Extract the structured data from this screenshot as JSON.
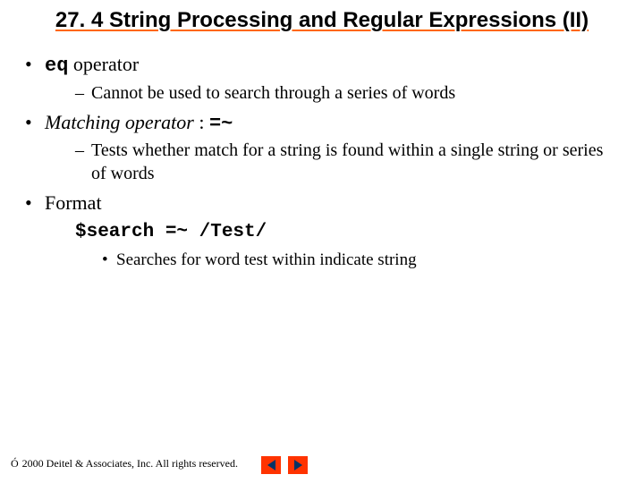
{
  "title": "27. 4 String Processing and Regular Expressions (II)",
  "bullets": {
    "b1_code": "eq",
    "b1_rest": " operator",
    "b1_sub1": "Cannot be used to search through a series of words",
    "b2_italic": "Matching operator",
    "b2_sep": " : ",
    "b2_code": "=~",
    "b2_sub1": "Tests whether match for a string is found within a single string or series of words",
    "b3": "Format",
    "b3_code": "$search =~ /Test/",
    "b3_sub1": "Searches for word test within indicate string"
  },
  "footer": {
    "copyright": "Ó",
    "text": "2000 Deitel & Associates, Inc.  All rights reserved."
  }
}
